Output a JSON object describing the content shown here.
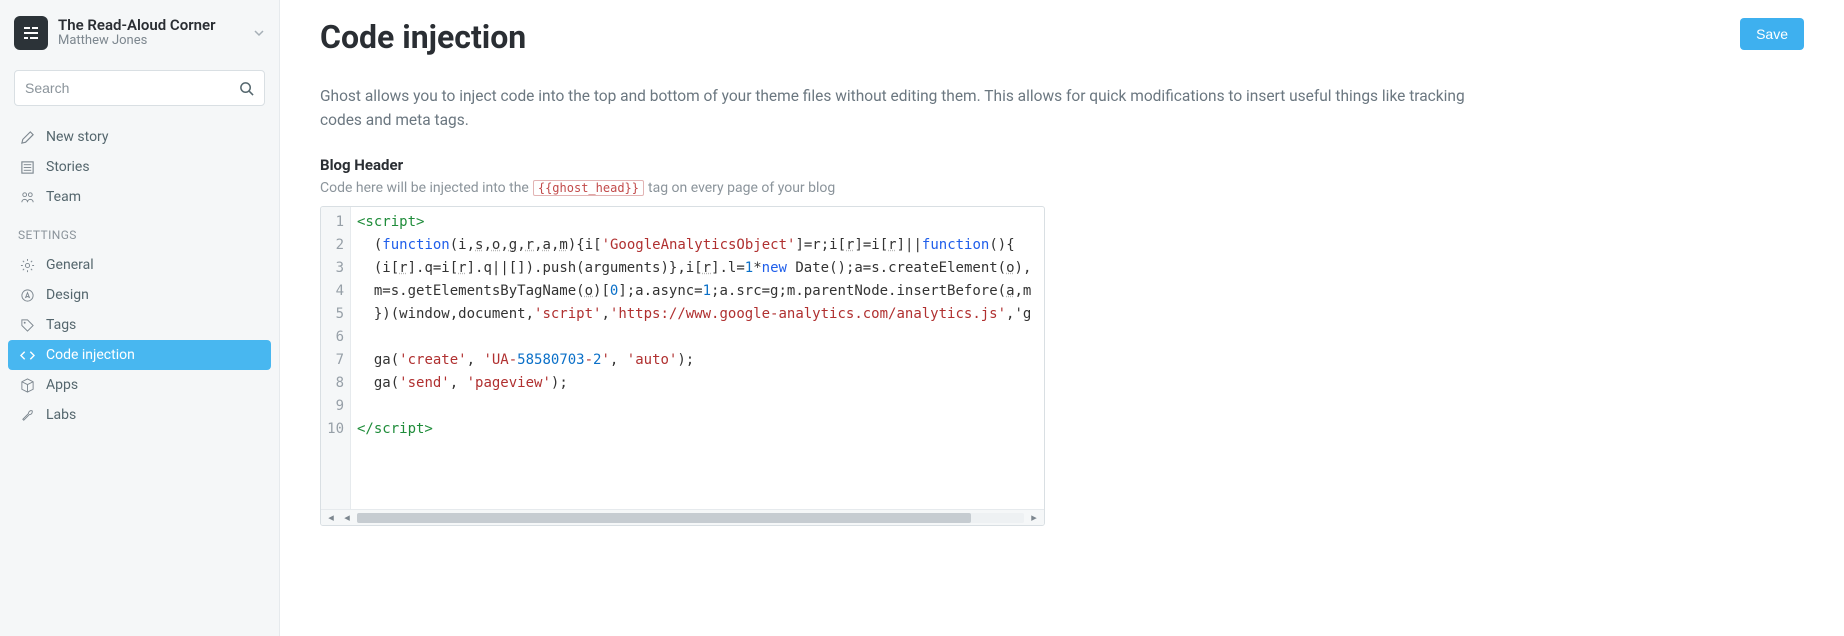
{
  "site": {
    "title": "The Read-Aloud Corner",
    "user": "Matthew Jones"
  },
  "search": {
    "placeholder": "Search"
  },
  "nav": {
    "primary": [
      {
        "label": "New story"
      },
      {
        "label": "Stories"
      },
      {
        "label": "Team"
      }
    ],
    "settings_heading": "SETTINGS",
    "settings": [
      {
        "label": "General"
      },
      {
        "label": "Design"
      },
      {
        "label": "Tags"
      },
      {
        "label": "Code injection"
      },
      {
        "label": "Apps"
      },
      {
        "label": "Labs"
      }
    ]
  },
  "page": {
    "title": "Code injection",
    "save_label": "Save",
    "intro": "Ghost allows you to inject code into the top and bottom of your theme files without editing them. This allows for quick modifications to insert useful things like tracking codes and meta tags."
  },
  "header_block": {
    "title": "Blog Header",
    "help_before": "Code here will be injected into the",
    "tag": "{{ghost_head}}",
    "help_after": "tag on every page of your blog"
  },
  "code": {
    "lines": [
      "<script>",
      "  (function(i,s,o,g,r,a,m){i['GoogleAnalyticsObject']=r;i[r]=i[r]||function(){",
      "  (i[r].q=i[r].q||[]).push(arguments)},i[r].l=1*new Date();a=s.createElement(o),",
      "  m=s.getElementsByTagName(o)[0];a.async=1;a.src=g;m.parentNode.insertBefore(a,m",
      "  })(window,document,'script','https://www.google-analytics.com/analytics.js','g",
      "",
      "  ga('create', 'UA-58580703-2', 'auto');",
      "  ga('send', 'pageview');",
      "",
      "</script>"
    ]
  }
}
